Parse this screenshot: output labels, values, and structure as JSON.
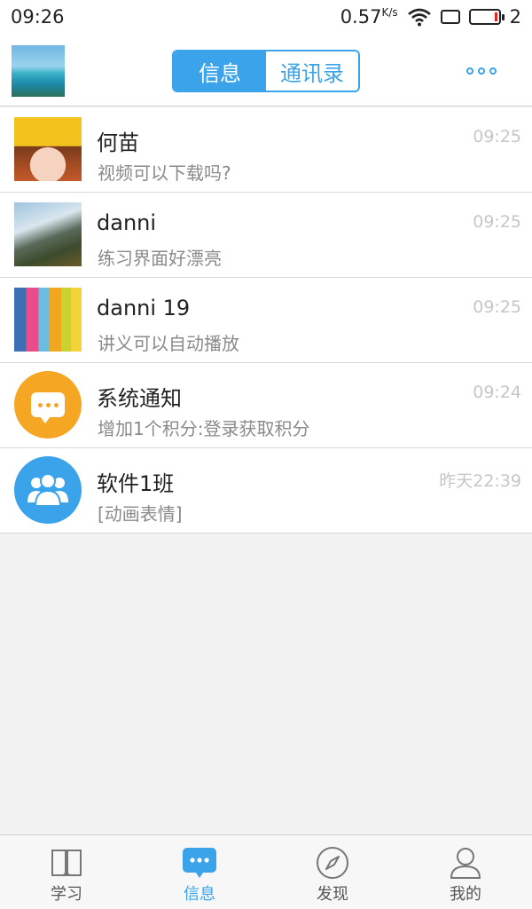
{
  "status_bar": {
    "time": "09:26",
    "speed": "0.57",
    "speed_unit": "K/s",
    "battery_text": "2"
  },
  "header": {
    "tabs": [
      {
        "label": "信息",
        "active": true
      },
      {
        "label": "通讯录",
        "active": false
      }
    ],
    "more_icon": "more-dots-icon"
  },
  "chats": [
    {
      "name": "何苗",
      "preview": "视频可以下载吗?",
      "time": "09:25",
      "avatar": "cartoon-girl"
    },
    {
      "name": "danni",
      "preview": "练习界面好漂亮",
      "time": "09:25",
      "avatar": "waterfall-landscape"
    },
    {
      "name": "danni 19",
      "preview": "讲义可以自动播放",
      "time": "09:25",
      "avatar": "beach-huts"
    },
    {
      "name": "系统通知",
      "preview": "增加1个积分:登录获取积分",
      "time": "09:24",
      "avatar": "system-notice-icon"
    },
    {
      "name": "软件1班",
      "preview": "[动画表情]",
      "time": "昨天22:39",
      "avatar": "group-icon"
    }
  ],
  "nav": [
    {
      "label": "学习",
      "icon": "book-icon",
      "active": false
    },
    {
      "label": "信息",
      "icon": "message-icon",
      "active": true
    },
    {
      "label": "发现",
      "icon": "compass-icon",
      "active": false
    },
    {
      "label": "我的",
      "icon": "user-icon",
      "active": false
    }
  ],
  "colors": {
    "accent": "#3aa3ea",
    "notice_orange": "#f5a623",
    "time_gray": "#c6c6c6",
    "preview_gray": "#8a8a8a"
  }
}
